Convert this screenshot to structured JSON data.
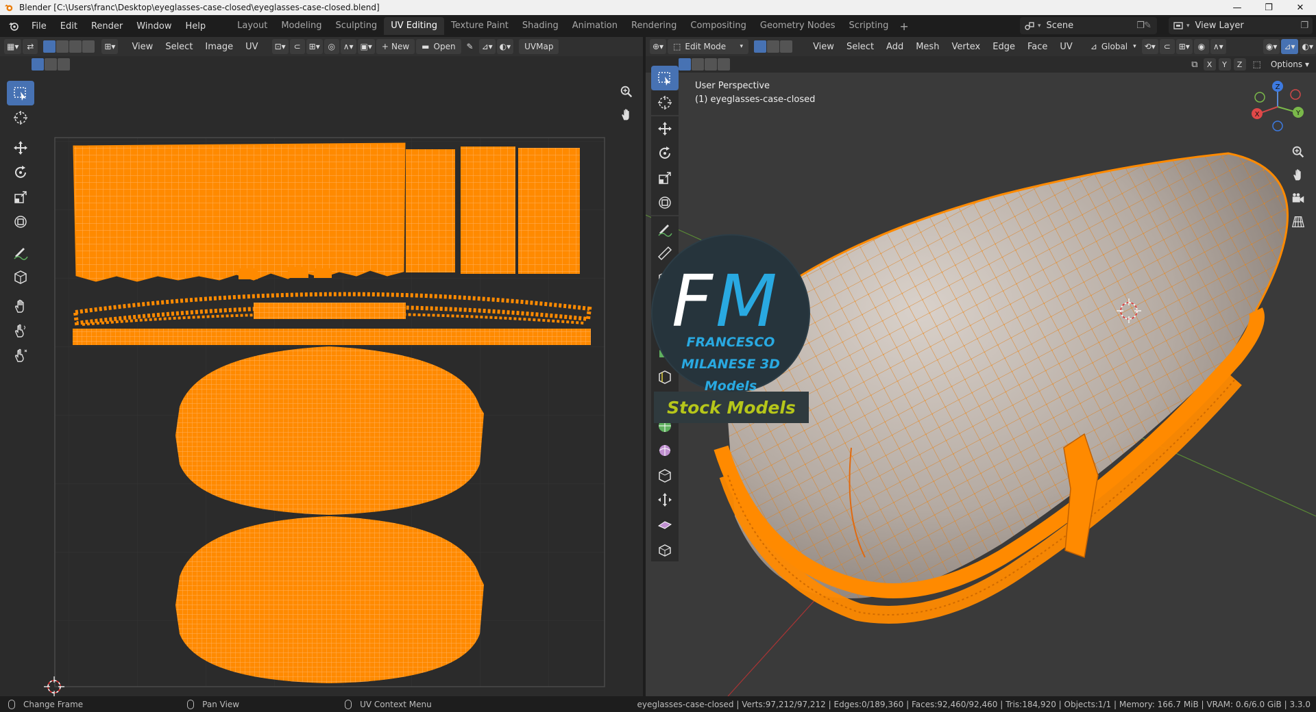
{
  "window": {
    "title": "Blender [C:\\Users\\franc\\Desktop\\eyeglasses-case-closed\\eyeglasses-case-closed.blend]",
    "minimize": "—",
    "maximize": "❐",
    "close": "✕"
  },
  "menu": [
    "File",
    "Edit",
    "Render",
    "Window",
    "Help"
  ],
  "workspaces": [
    "Layout",
    "Modeling",
    "Sculpting",
    "UV Editing",
    "Texture Paint",
    "Shading",
    "Animation",
    "Rendering",
    "Compositing",
    "Geometry Nodes",
    "Scripting"
  ],
  "active_workspace": "UV Editing",
  "scene": {
    "label": "Scene"
  },
  "view_layer": {
    "label": "View Layer"
  },
  "uv_editor": {
    "menus": [
      "View",
      "Select",
      "Image",
      "UV"
    ],
    "new_label": "New",
    "open_label": "Open",
    "uvmap_label": "UVMap"
  },
  "viewport": {
    "mode_label": "Edit Mode",
    "menus": [
      "View",
      "Select",
      "Add",
      "Mesh",
      "Vertex",
      "Edge",
      "Face",
      "UV"
    ],
    "transform_orientation": "Global",
    "options_label": "Options",
    "axes_x": "X",
    "axes_y": "Y",
    "axes_z": "Z",
    "overlay_line1": "User Perspective",
    "overlay_line2": "(1) eyeglasses-case-closed",
    "gizmo": {
      "z": "Z",
      "y": "Y",
      "x": "X"
    }
  },
  "watermark": {
    "logo_text": "FRANCESCO MILANESE 3D Models",
    "banner": "Stock Models"
  },
  "status": {
    "items": [
      "Change Frame",
      "Pan View",
      "UV Context Menu"
    ],
    "stats": "eyeglasses-case-closed | Verts:97,212/97,212 | Edges:0/189,360 | Faces:92,460/92,460 | Tris:184,920 | Objects:1/1 | Memory: 166.7 MiB | VRAM: 0.6/6.0 GiB | 3.3.0"
  },
  "colors": {
    "accent": "#4772b3",
    "selection": "#ff8a00",
    "mesh": "#bfb5ac"
  }
}
